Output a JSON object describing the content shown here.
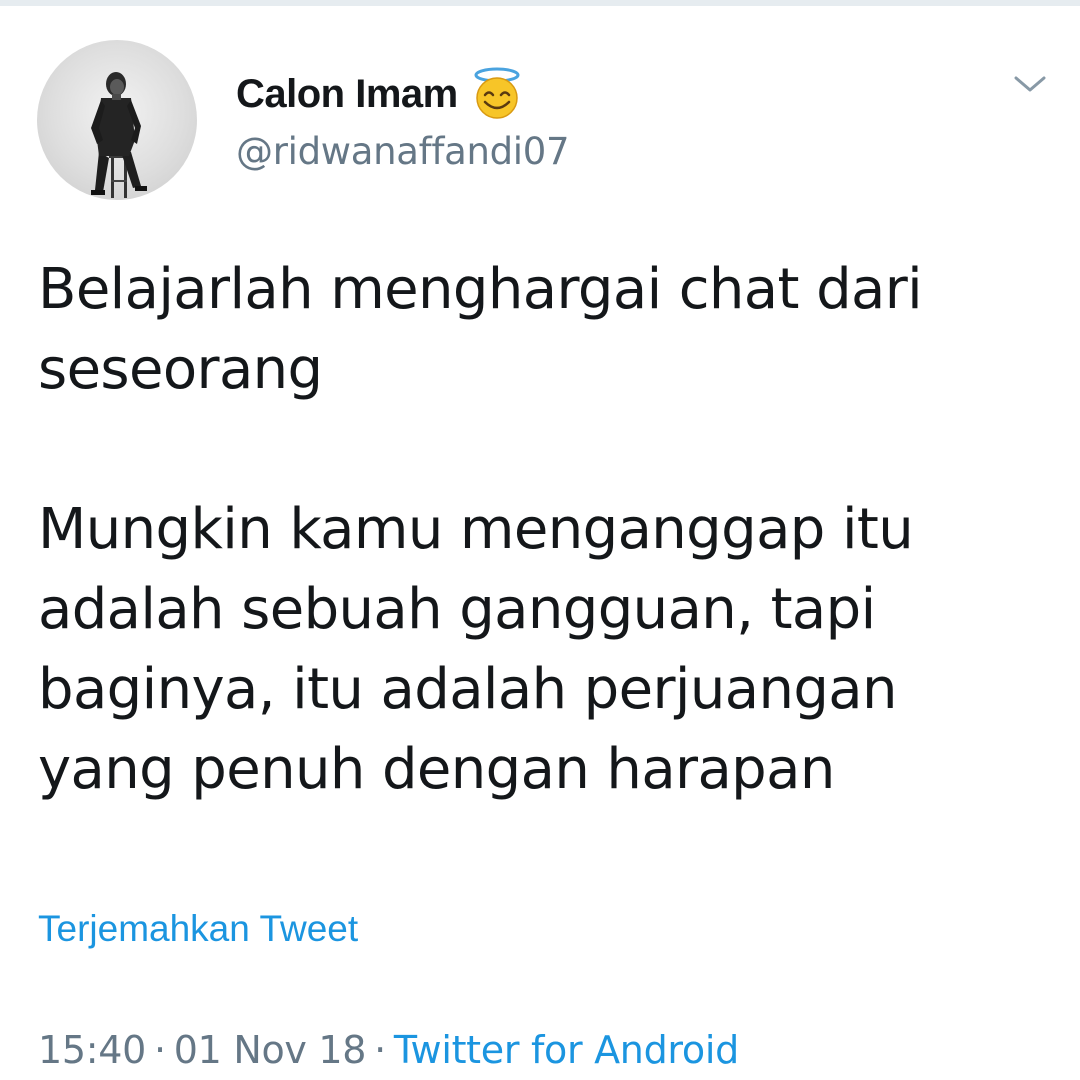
{
  "author": {
    "display_name": "Calon Imam",
    "name_emoji": "smiling-face-with-halo",
    "handle": "@ridwanaffandi07"
  },
  "tweet": {
    "paragraphs": [
      "Belajarlah menghargai chat dari seseorang",
      "Mungkin kamu menganggap itu adalah sebuah gangguan, tapi baginya, itu adalah perjuangan yang penuh dengan harapan"
    ],
    "translate_label": "Terjemahkan Tweet"
  },
  "meta": {
    "time": "15:40",
    "separator": "·",
    "date": "01 Nov 18",
    "source": "Twitter for Android"
  },
  "icons": {
    "caret": "chevron-down-icon",
    "avatar": "profile-photo"
  },
  "colors": {
    "text": "#14171a",
    "secondary": "#657786",
    "link": "#1b95e0",
    "background": "#ffffff"
  }
}
